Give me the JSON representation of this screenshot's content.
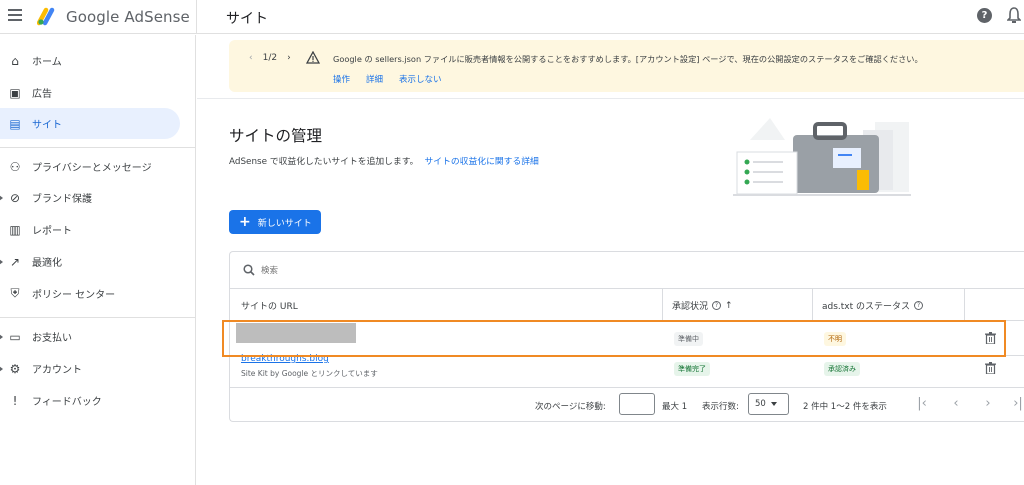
{
  "app": {
    "brand": "Google AdSense",
    "page_heading": "サイト"
  },
  "sidebar": {
    "items": [
      {
        "label": "ホーム",
        "icon": "home-icon"
      },
      {
        "label": "広告",
        "icon": "ads-icon"
      },
      {
        "label": "サイト",
        "icon": "sites-icon",
        "active": true
      },
      {
        "label": "プライバシーとメッセージ",
        "icon": "privacy-icon"
      },
      {
        "label": "ブランド保護",
        "icon": "block-icon"
      },
      {
        "label": "レポート",
        "icon": "reports-icon"
      },
      {
        "label": "最適化",
        "icon": "optimize-icon"
      },
      {
        "label": "ポリシー センター",
        "icon": "policy-icon"
      },
      {
        "label": "お支払い",
        "icon": "payments-icon"
      },
      {
        "label": "アカウント",
        "icon": "gear-icon"
      },
      {
        "label": "フィードバック",
        "icon": "feedback-icon"
      }
    ]
  },
  "banner": {
    "pager": "1/2",
    "message": "Google の sellers.json ファイルに販売者情報を公開することをおすすめします。[アカウント設定] ページで、現在の公開設定のステータスをご確認ください。",
    "actions": [
      "操作",
      "詳細",
      "表示しない"
    ]
  },
  "main": {
    "title": "サイトの管理",
    "subtitle": "AdSense で収益化したいサイトを追加します。",
    "subtitle_link": "サイトの収益化に関する詳細",
    "new_site_button": "新しいサイト"
  },
  "table": {
    "search_placeholder": "検索",
    "columns": [
      "サイトの URL",
      "承認状況",
      "ads.txt のステータス"
    ],
    "rows": [
      {
        "url": "",
        "url_sub": "",
        "approval": "準備中",
        "ads_txt": "不明"
      },
      {
        "url": "breakthroughs.blog",
        "url_sub": "Site Kit by Google とリンクしています",
        "approval": "準備完了",
        "ads_txt": "承認済み"
      }
    ],
    "pagination": {
      "goto_label": "次のページに移動:",
      "max_label": "最大 1",
      "rows_label": "表示行数:",
      "rows_value": "50",
      "count_label": "2 件中 1〜2 件を表示"
    }
  }
}
